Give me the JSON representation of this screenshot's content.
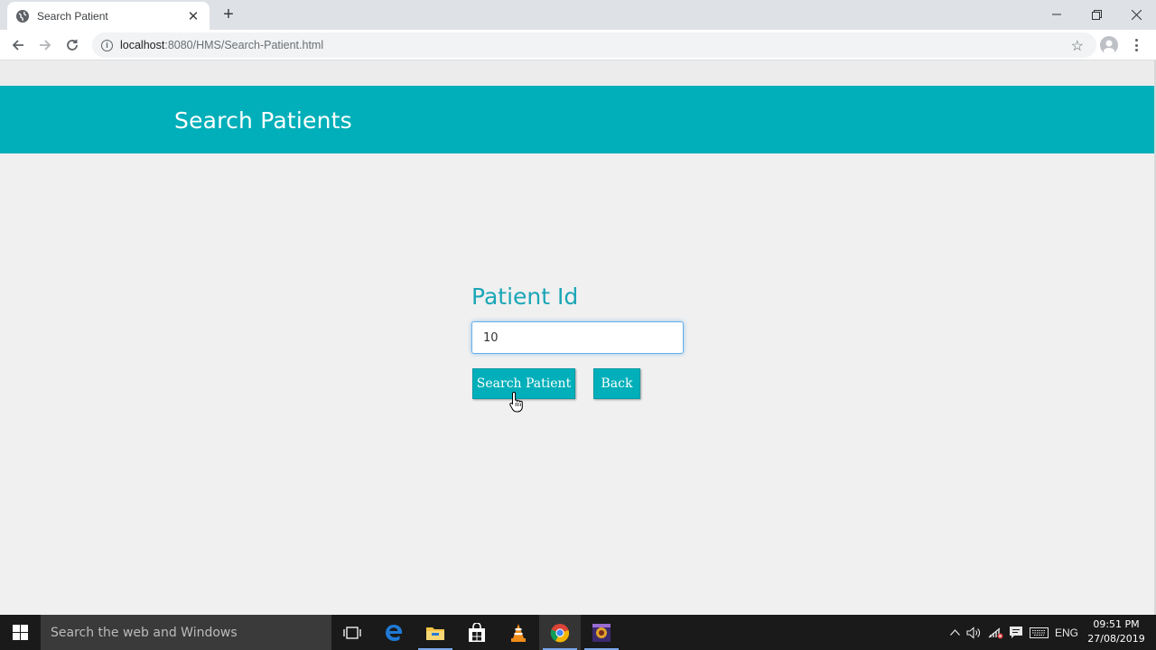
{
  "browser": {
    "tab_title": "Search Patient",
    "tab_close": "✕",
    "new_tab": "+",
    "window_controls": {
      "minimize": "—",
      "restore": "❐",
      "close": "✕"
    },
    "url_host": "localhost",
    "url_path": ":8080/HMS/Search-Patient.html",
    "icons": [
      "globe-icon",
      "close-icon",
      "back-arrow-icon",
      "forward-arrow-icon",
      "reload-icon",
      "info-icon",
      "star-icon",
      "profile-icon",
      "menu-icon"
    ]
  },
  "page": {
    "title": "Search Patients",
    "field_label": "Patient Id",
    "field_value": "10",
    "search_button": "Search Patient",
    "back_button": "Back",
    "colors": {
      "header": "#00afb9",
      "label": "#1aa6b7",
      "background": "#f0f0f0"
    }
  },
  "taskbar": {
    "search_placeholder": "Search the web and Windows",
    "language": "ENG",
    "time": "09:51 PM",
    "date": "27/08/2019",
    "apps": [
      "task-view",
      "edge",
      "file-explorer",
      "store",
      "vlc",
      "chrome",
      "app"
    ]
  }
}
